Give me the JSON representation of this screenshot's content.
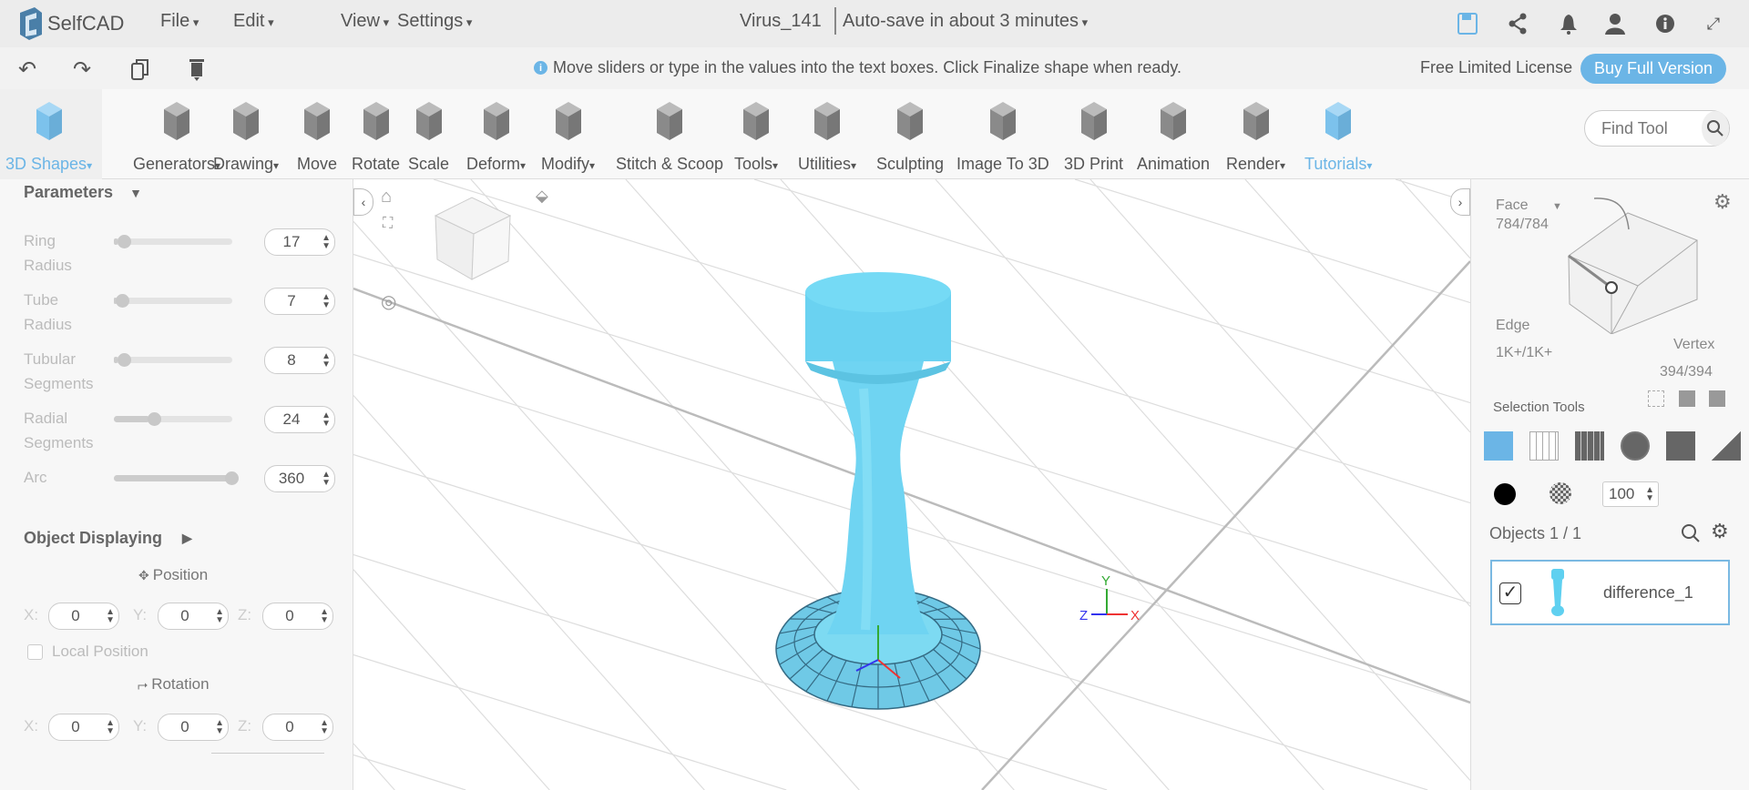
{
  "app": {
    "logo": "SelfCAD",
    "menus": [
      "File",
      "Edit",
      "View",
      "Settings"
    ],
    "project": "Virus_141",
    "autosave": "Auto-save in about 3 minutes"
  },
  "top_icons": [
    "save-icon",
    "share-icon",
    "bell-icon",
    "user-icon",
    "info-icon",
    "fullscreen-icon"
  ],
  "msg": {
    "text": "Move sliders or type in the values into the text boxes. Click Finalize shape when ready.",
    "license": "Free Limited License",
    "buy": "Buy Full Version"
  },
  "tools": [
    {
      "label": "3D Shapes",
      "dd": true,
      "active": true
    },
    {
      "label": "Generators",
      "dd": true
    },
    {
      "label": "Drawing",
      "dd": true
    },
    {
      "label": "Move"
    },
    {
      "label": "Rotate"
    },
    {
      "label": "Scale"
    },
    {
      "label": "Deform",
      "dd": true
    },
    {
      "label": "Modify",
      "dd": true
    },
    {
      "label": "Stitch & Scoop"
    },
    {
      "label": "Tools",
      "dd": true
    },
    {
      "label": "Utilities",
      "dd": true
    },
    {
      "label": "Sculpting"
    },
    {
      "label": "Image To 3D"
    },
    {
      "label": "3D Print"
    },
    {
      "label": "Animation"
    },
    {
      "label": "Render",
      "dd": true
    },
    {
      "label": "Tutorials",
      "dd": true,
      "active": true
    }
  ],
  "find_tool": {
    "placeholder": "Find Tool"
  },
  "params": {
    "title": "Parameters",
    "rows": [
      {
        "l1": "Ring",
        "l2": "Radius",
        "value": "17",
        "frac": 0.03
      },
      {
        "l1": "Tube",
        "l2": "Radius",
        "value": "7",
        "frac": 0.02
      },
      {
        "l1": "Tubular",
        "l2": "Segments",
        "value": "8",
        "frac": 0.03
      },
      {
        "l1": "Radial",
        "l2": "Segments",
        "value": "24",
        "frac": 0.3
      },
      {
        "l1": "Arc",
        "l2": "",
        "value": "360",
        "frac": 1.0
      }
    ]
  },
  "display": {
    "title": "Object Displaying",
    "position": "Position",
    "rotation": "Rotation",
    "local": "Local Position",
    "x": "X:",
    "y": "Y:",
    "z": "Z:",
    "pos": [
      "0",
      "0",
      "0"
    ],
    "rot": [
      "0",
      "0",
      "0"
    ]
  },
  "right": {
    "face": "Face",
    "face_count": "784/784",
    "edge": "Edge",
    "edge_count": "1K+/1K+",
    "vertex": "Vertex",
    "vertex_count": "394/394",
    "selection_tools": "Selection Tools",
    "opacity": "100",
    "objects": "Objects 1 / 1",
    "object_name": "difference_1"
  },
  "axes": {
    "y": "Y",
    "x": "X",
    "z": "Z"
  },
  "colors": {
    "accent": "#6bb5e6",
    "object": "#6dd3f0"
  }
}
